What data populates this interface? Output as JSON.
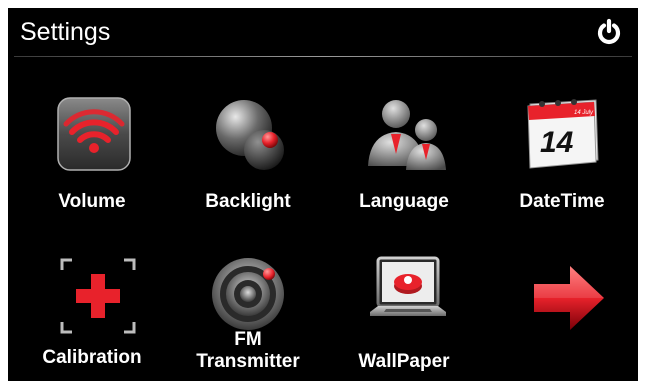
{
  "header": {
    "title": "Settings"
  },
  "items": [
    {
      "label": "Volume",
      "icon": "volume-icon"
    },
    {
      "label": "Backlight",
      "icon": "backlight-icon"
    },
    {
      "label": "Language",
      "icon": "language-icon"
    },
    {
      "label": "DateTime",
      "icon": "calendar-icon",
      "calendar_day": "14",
      "calendar_month": "14 July"
    },
    {
      "label": "Calibration",
      "icon": "calibration-icon"
    },
    {
      "label": "FM Transmitter",
      "label_line1": "FM",
      "label_line2": "Transmitter",
      "icon": "fm-transmitter-icon"
    },
    {
      "label": "WallPaper",
      "icon": "wallpaper-icon"
    }
  ],
  "next": {
    "icon": "next-arrow-icon"
  },
  "colors": {
    "accent": "#e8222b",
    "background": "#000000",
    "text": "#ffffff"
  }
}
